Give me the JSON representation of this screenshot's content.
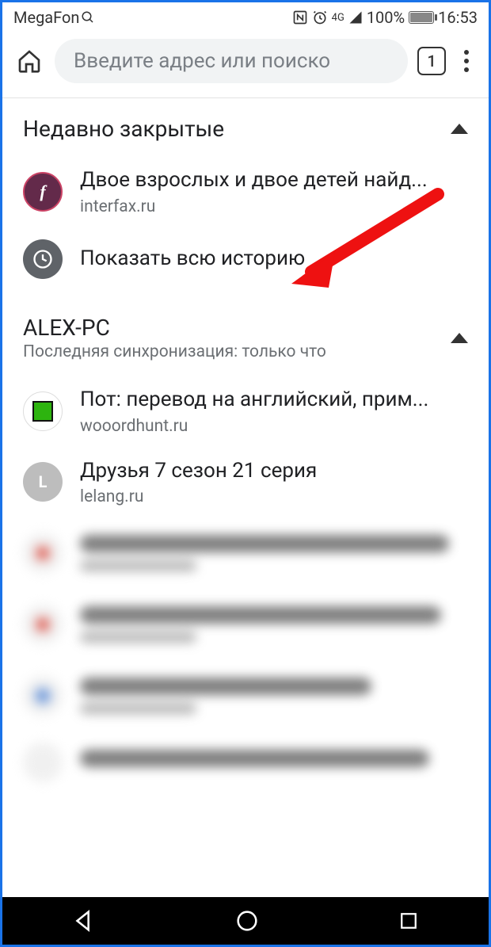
{
  "status": {
    "carrier": "MegaFon",
    "network_label": "4G",
    "battery_pct": "100%",
    "time": "16:53"
  },
  "toolbar": {
    "omnibox_placeholder": "Введите адрес или поиско",
    "tab_count": "1"
  },
  "sections": {
    "recent": {
      "title": "Недавно закрытые"
    },
    "device": {
      "title": "ALEX-PC",
      "subtitle": "Последняя синхронизация: только что"
    }
  },
  "rows": {
    "interfax": {
      "title": "Двое взрослых и двое детей найд...",
      "url": "interfax.ru",
      "fav_letter": "f"
    },
    "history": {
      "title": "Показать всю историю"
    },
    "wooord": {
      "title": "Пот: перевод на английский, прим...",
      "url": "wooordhunt.ru"
    },
    "lelang": {
      "title": "Друзья 7 сезон 21 серия",
      "url": "lelang.ru",
      "fav_letter": "L"
    }
  }
}
